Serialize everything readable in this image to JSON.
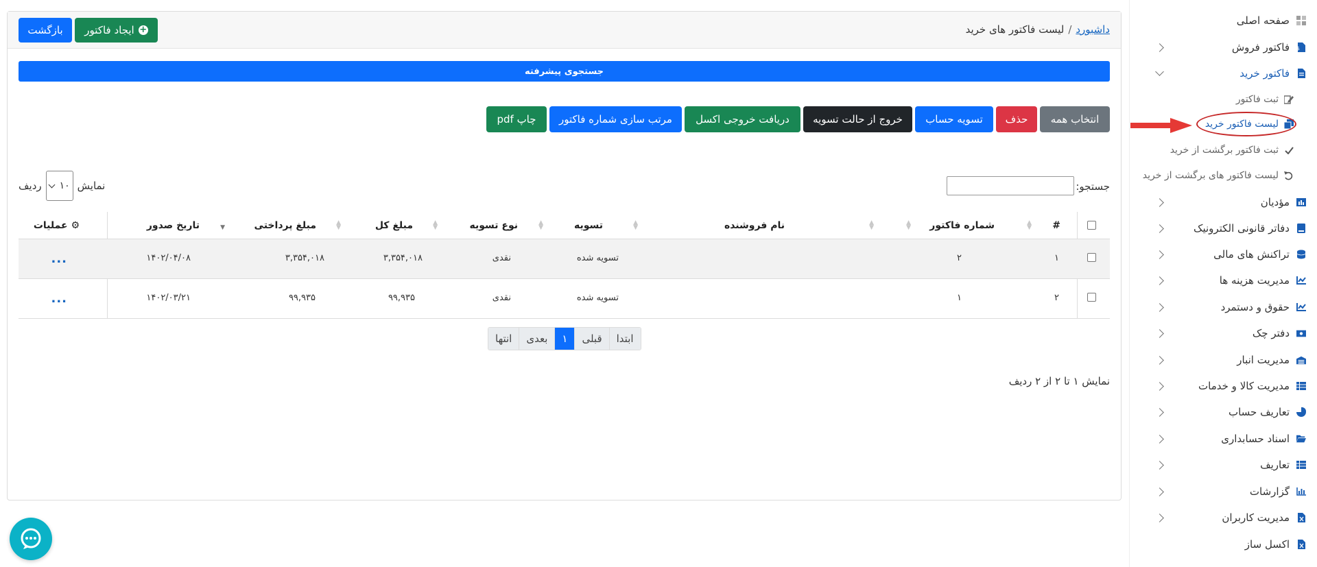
{
  "header": {
    "breadcrumb_home": "داشبورد",
    "breadcrumb_sep": "/",
    "breadcrumb_current": "لیست فاکتور های خرید",
    "create_label": "ایجاد فاکتور",
    "back_label": "بازگشت"
  },
  "advanced_search_label": "جستجوی پیشرفته",
  "toolbar": {
    "select_all": "انتخاب همه",
    "delete": "حذف",
    "settle": "تسویه حساب",
    "unsettle": "خروج از حالت تسویه",
    "excel": "دریافت خروجی اکسل",
    "sort_numbers": "مرتب سازی شماره فاکتور",
    "print_pdf": "چاپ pdf"
  },
  "search": {
    "label": "جستجو:",
    "value": ""
  },
  "length": {
    "prefix": "نمایش",
    "value": "۱۰",
    "suffix": "ردیف"
  },
  "table": {
    "headers": {
      "num": "#",
      "invoice_no": "شماره فاکتور",
      "vendor": "نام فروشنده",
      "settlement": "تسویه",
      "settle_type": "نوع تسویه",
      "total": "مبلغ کل",
      "paid": "مبلغ پرداختی",
      "date": "تاریخ صدور",
      "ops": "عملیات"
    },
    "rows": [
      {
        "num": "۱",
        "invoice_no": "۲",
        "vendor": "",
        "settlement": "تسویه شده",
        "settle_type": "نقدی",
        "total": "۳,۳۵۴,۰۱۸",
        "paid": "۳,۳۵۴,۰۱۸",
        "date": "۱۴۰۲/۰۴/۰۸",
        "ops": "..."
      },
      {
        "num": "۲",
        "invoice_no": "۱",
        "vendor": "",
        "settlement": "تسویه شده",
        "settle_type": "نقدی",
        "total": "۹۹,۹۳۵",
        "paid": "۹۹,۹۳۵",
        "date": "۱۴۰۲/۰۳/۲۱",
        "ops": "..."
      }
    ]
  },
  "pagination": {
    "first": "ابتدا",
    "prev": "قبلی",
    "current": "۱",
    "next": "بعدی",
    "last": "انتها"
  },
  "info_text": "نمایش ۱ تا ۲ از ۲ ردیف",
  "sidebar": {
    "items": [
      {
        "label": "صفحه اصلی"
      },
      {
        "label": "فاکتور فروش"
      },
      {
        "label": "فاکتور خرید"
      },
      {
        "label": "مؤدیان"
      },
      {
        "label": "دفاتر قانونی الکترونیک"
      },
      {
        "label": "تراکنش های مالی"
      },
      {
        "label": "مدیریت هزینه ها"
      },
      {
        "label": "حقوق و دستمرد"
      },
      {
        "label": "دفتر چک"
      },
      {
        "label": "مدیریت انبار"
      },
      {
        "label": "مدیریت کالا و خدمات"
      },
      {
        "label": "تعاریف حساب"
      },
      {
        "label": "اسناد حسابداری"
      },
      {
        "label": "تعاریف"
      },
      {
        "label": "گزارشات"
      },
      {
        "label": "مدیریت کاربران"
      },
      {
        "label": "اکسل ساز"
      }
    ],
    "sub_items": [
      {
        "label": "ثبت فاکتور"
      },
      {
        "label": "لیست فاکتور خرید"
      },
      {
        "label": "ثبت فاکتور برگشت از خرید"
      },
      {
        "label": "لیست فاکتور های برگشت از خرید"
      }
    ]
  },
  "colors": {
    "primary": "#0d6efd",
    "success": "#198754",
    "danger": "#dc3545",
    "secondary": "#6c757d",
    "dark": "#212529",
    "highlight": "#c62828",
    "chat": "#0bb2c7"
  }
}
